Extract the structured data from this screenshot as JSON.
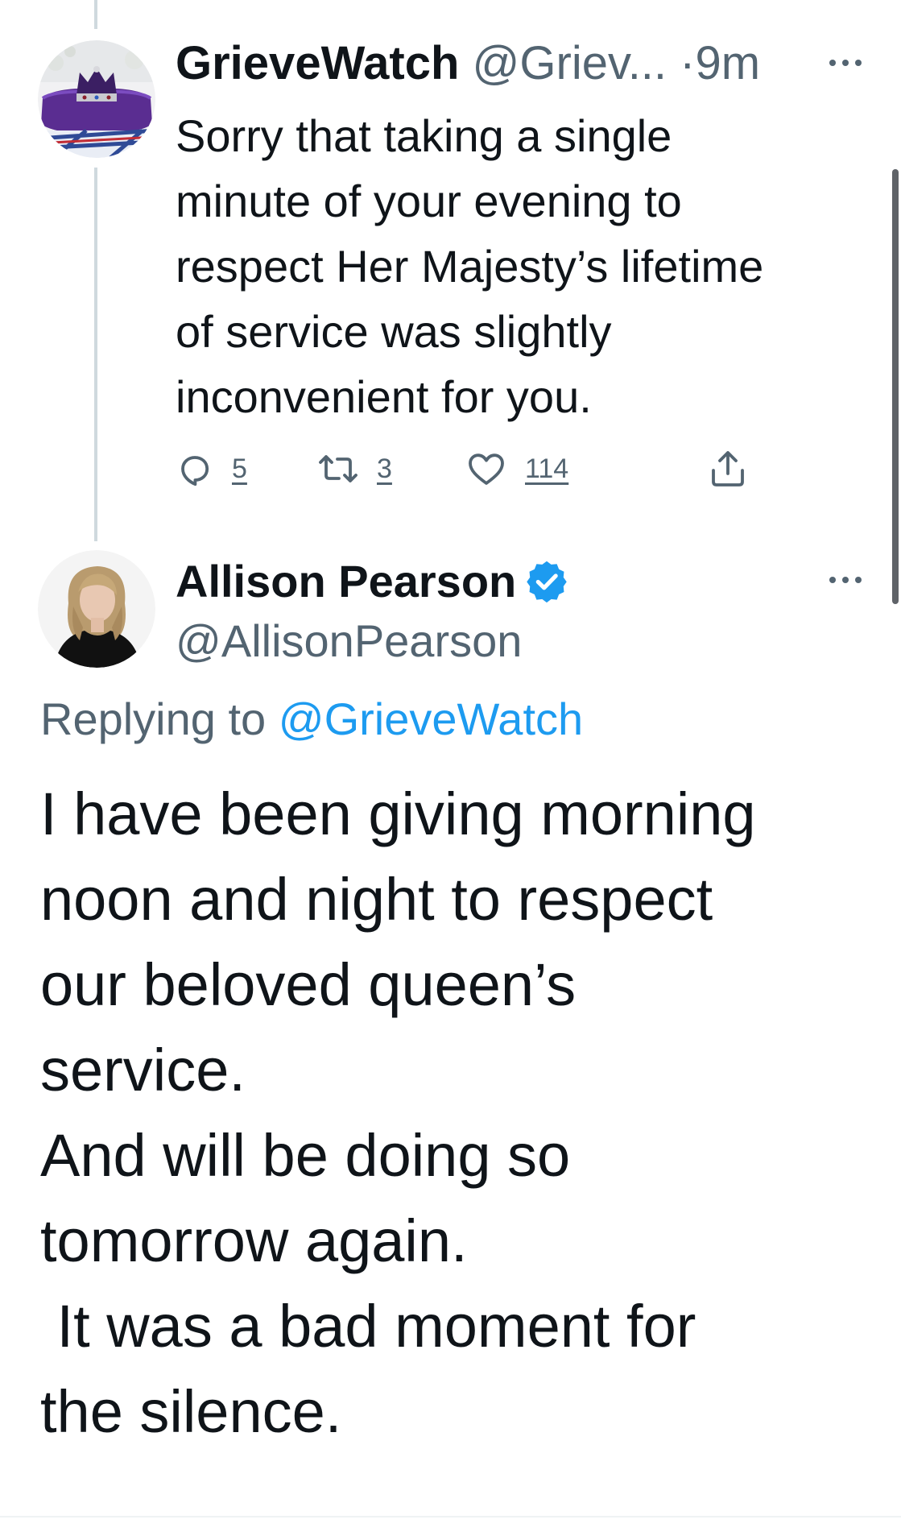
{
  "parent_tweet": {
    "display_name": "GrieveWatch",
    "handle": "@Griev...",
    "separator": "·",
    "time": "9m",
    "body_lines": [
      "Sorry that taking a single",
      "minute of your evening to",
      "respect Her Majesty’s lifetime",
      "of service was slightly",
      "inconvenient for you."
    ],
    "actions": {
      "reply_count": "5",
      "retweet_count": "3",
      "like_count": "114"
    },
    "avatar_icon": "crown-on-cushion-avatar"
  },
  "reply_tweet": {
    "display_name": "Allison Pearson",
    "handle": "@AllisonPearson",
    "verified_icon": "verified-badge-icon",
    "replying_to_label": "Replying to ",
    "replying_to_mention": "@GrieveWatch",
    "body_lines": [
      "I have been giving morning",
      "noon and night to respect",
      "our beloved queen’s",
      "service.",
      "And will be doing so",
      "tomorrow again.",
      " It was a bad moment for",
      "the silence."
    ],
    "avatar_icon": "profile-photo-avatar"
  },
  "colors": {
    "text_primary": "#0f1419",
    "text_secondary": "#536471",
    "link": "#1d9bf0",
    "thread_line": "#cfd9de"
  },
  "icons": {
    "reply": "reply-icon",
    "retweet": "retweet-icon",
    "like": "heart-icon",
    "share": "share-icon",
    "more": "more-options-icon"
  }
}
